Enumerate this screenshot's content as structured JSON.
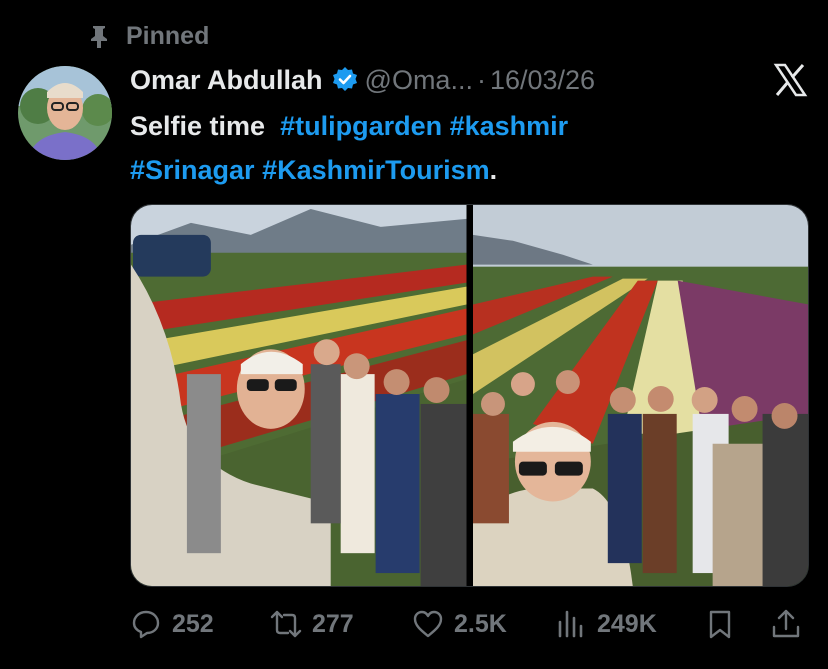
{
  "pinned_label": "Pinned",
  "author": {
    "name": "Omar Abdullah",
    "handle": "@Oma...",
    "date": "16/03/26"
  },
  "post": {
    "text": "Selfie time",
    "hashtags": [
      "#tulipgarden",
      "#kashmir",
      "#Srinagar",
      "#KashmirTourism"
    ],
    "trailing": "."
  },
  "actions": {
    "replies": "252",
    "reposts": "277",
    "likes": "2.5K",
    "views": "249K"
  },
  "colors": {
    "accent": "#1d9bf0",
    "muted": "#71767b",
    "text": "#e7e9ea",
    "background": "#000000"
  },
  "icons": [
    "pin-icon",
    "verified-badge-icon",
    "x-logo-icon",
    "reply-icon",
    "repost-icon",
    "like-icon",
    "views-icon",
    "bookmark-icon",
    "share-icon"
  ]
}
